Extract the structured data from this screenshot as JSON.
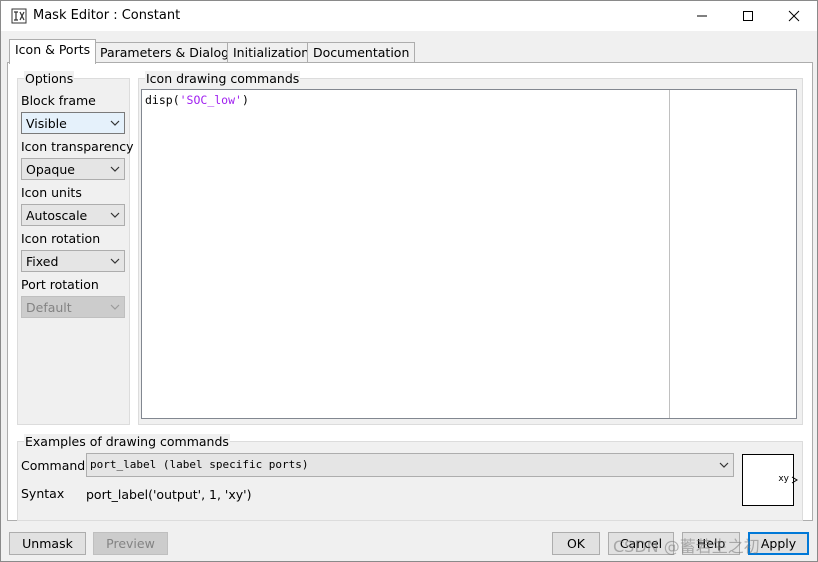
{
  "window": {
    "title": "Mask Editor : Constant"
  },
  "tabs": [
    {
      "label": "Icon & Ports"
    },
    {
      "label": "Parameters & Dialog"
    },
    {
      "label": "Initialization"
    },
    {
      "label": "Documentation"
    }
  ],
  "options": {
    "group_label": "Options",
    "block_frame": {
      "label": "Block frame",
      "value": "Visible"
    },
    "icon_transparency": {
      "label": "Icon transparency",
      "value": "Opaque"
    },
    "icon_units": {
      "label": "Icon units",
      "value": "Autoscale"
    },
    "icon_rotation": {
      "label": "Icon rotation",
      "value": "Fixed"
    },
    "port_rotation": {
      "label": "Port rotation",
      "value": "Default"
    }
  },
  "drawing": {
    "group_label": "Icon drawing commands",
    "code_func": "disp(",
    "code_string": "'SOC_low'",
    "code_close": ")"
  },
  "examples": {
    "group_label": "Examples of drawing commands",
    "command_label": "Command",
    "command_value": "port_label (label specific ports)",
    "syntax_label": "Syntax",
    "syntax_value": "port_label('output', 1, 'xy')",
    "preview_port_text": "xy"
  },
  "buttons": {
    "unmask": "Unmask",
    "preview": "Preview",
    "ok": "OK",
    "cancel": "Cancel",
    "help": "Help",
    "apply": "Apply"
  },
  "watermark": "CSDN @蓄若生之初"
}
